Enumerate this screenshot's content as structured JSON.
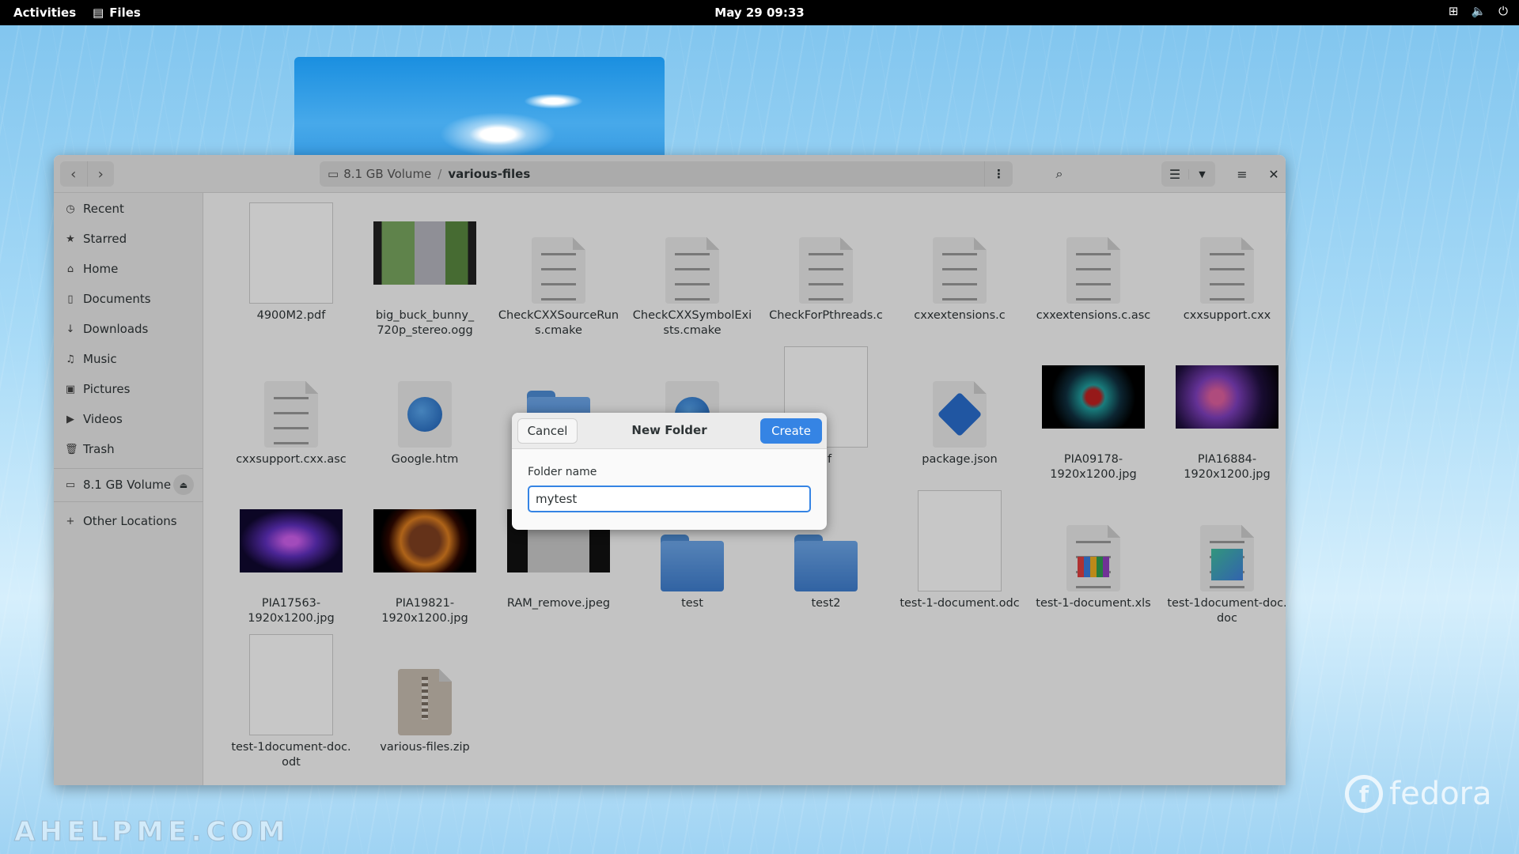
{
  "topbar": {
    "activities": "Activities",
    "app_name": "Files",
    "clock": "May 29  09:33"
  },
  "headerbar": {
    "volume_crumb": "8.1 GB Volume",
    "separator": "/",
    "current_folder": "various-files"
  },
  "sidebar": {
    "items": [
      {
        "label": "Recent",
        "icon": "clock-icon"
      },
      {
        "label": "Starred",
        "icon": "star-icon"
      },
      {
        "label": "Home",
        "icon": "home-icon"
      },
      {
        "label": "Documents",
        "icon": "document-icon"
      },
      {
        "label": "Downloads",
        "icon": "download-icon"
      },
      {
        "label": "Music",
        "icon": "music-icon"
      },
      {
        "label": "Pictures",
        "icon": "picture-icon"
      },
      {
        "label": "Videos",
        "icon": "video-icon"
      },
      {
        "label": "Trash",
        "icon": "trash-icon"
      }
    ],
    "volume": "8.1 GB Volume",
    "other_locations": "Other Locations"
  },
  "files": [
    {
      "name": "4900M2.pdf",
      "kind": "page"
    },
    {
      "name": "big_buck_bunny_\n720p_stereo.ogg",
      "kind": "video"
    },
    {
      "name": "CheckCXXSourceRun\ns.cmake",
      "kind": "doc"
    },
    {
      "name": "CheckCXXSymbolExi\nsts.cmake",
      "kind": "doc"
    },
    {
      "name": "CheckForPthreads.c",
      "kind": "doc"
    },
    {
      "name": "cxxextensions.c",
      "kind": "doc"
    },
    {
      "name": "cxxextensions.c.asc",
      "kind": "doc"
    },
    {
      "name": "cxxsupport.cxx",
      "kind": "doc"
    },
    {
      "name": "cxxsupport.cxx.asc",
      "kind": "doc"
    },
    {
      "name": "Google.htm",
      "kind": "globe"
    },
    {
      "name": "",
      "kind": "folder"
    },
    {
      "name": "",
      "kind": "globe"
    },
    {
      "name": "df",
      "kind": "page"
    },
    {
      "name": "package.json",
      "kind": "json"
    },
    {
      "name": "PIA09178-\n1920x1200.jpg",
      "kind": "photo-helix"
    },
    {
      "name": "PIA16884-\n1920x1200.jpg",
      "kind": "photo-nebula"
    },
    {
      "name": "PIA17563-\n1920x1200.jpg",
      "kind": "photo-purple"
    },
    {
      "name": "PIA19821-\n1920x1200.jpg",
      "kind": "photo-sun"
    },
    {
      "name": "RAM_remove.jpeg",
      "kind": "photo-ram"
    },
    {
      "name": "test",
      "kind": "folder"
    },
    {
      "name": "test2",
      "kind": "folder"
    },
    {
      "name": "test-1-document.odc",
      "kind": "page"
    },
    {
      "name": "test-1-document.xls",
      "kind": "sheet"
    },
    {
      "name": "test-1document-doc.\ndoc",
      "kind": "docimg"
    },
    {
      "name": "test-1document-doc.\nodt",
      "kind": "page"
    },
    {
      "name": "various-files.zip",
      "kind": "zip"
    }
  ],
  "dialog": {
    "title": "New Folder",
    "cancel": "Cancel",
    "create": "Create",
    "field_label": "Folder name",
    "field_value": "mytest"
  },
  "desktop": {
    "watermark": "AHELPME.COM",
    "fedora": "fedora"
  }
}
